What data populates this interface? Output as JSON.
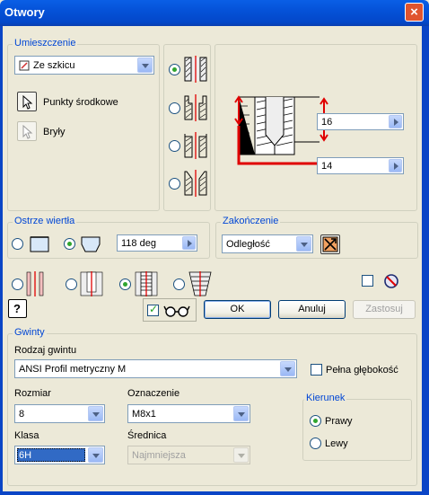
{
  "window": {
    "title": "Otwory",
    "close_icon": "×"
  },
  "placement": {
    "group_label": "Umieszczenie",
    "source_value": "Ze szkicu",
    "centers_label": "Punkty środkowe",
    "solids_label": "Bryły"
  },
  "hole_types": {
    "selected_index": 0,
    "count": 4
  },
  "preview": {
    "depth_value": "16",
    "length_value": "14"
  },
  "drill_point": {
    "group_label": "Ostrze wiertła",
    "selected": "angled",
    "angle_value": "118 deg"
  },
  "termination": {
    "group_label": "Zakończenie",
    "value": "Odległość"
  },
  "thread_types": {
    "selected_index": 2
  },
  "buttons": {
    "ok": "OK",
    "cancel": "Anuluj",
    "apply": "Zastosuj"
  },
  "threads": {
    "group_label": "Gwinty",
    "type_label": "Rodzaj gwintu",
    "type_value": "ANSI Profil metryczny M",
    "full_depth_label": "Pełna głębokość",
    "full_depth_checked": false,
    "size_label": "Rozmiar",
    "size_value": "8",
    "designation_label": "Oznaczenie",
    "designation_value": "M8x1",
    "class_label": "Klasa",
    "class_value": "6H",
    "diameter_label": "Średnica",
    "diameter_value": "Najmniejsza",
    "direction_label": "Kierunek",
    "right_label": "Prawy",
    "left_label": "Lewy",
    "direction": "right"
  },
  "colors": {
    "accent_red": "#e00000",
    "title_blue": "#0a5fe6",
    "group_label_blue": "#0046d5"
  }
}
